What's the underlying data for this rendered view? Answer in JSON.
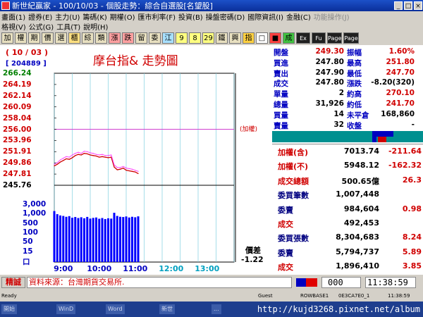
{
  "window": {
    "title": "新世紀贏家 - 100/10/03 - 個股走勢：綜合自選股[名望股]"
  },
  "menu": {
    "row1": [
      "畫面(1)",
      "證券(E)",
      "主力(U)",
      "籌碼(K)",
      "期權(O)",
      "匯市利率(F)",
      "投資(B)",
      "操盤密碼(D)",
      "國際資訊(I)",
      "金融(C)",
      "功能操作(J)"
    ],
    "row1_disabled": "功能操作(J)",
    "row2": [
      "格視(V)",
      "公式(G)",
      "工具(T)",
      "說明(H)"
    ]
  },
  "toolbar": {
    "chars": [
      "加",
      "權",
      "期",
      "價",
      "選",
      "櫃",
      "綜",
      "類",
      "漲",
      "跌",
      "留",
      "委",
      "江",
      "9",
      "8",
      "29",
      "鐵",
      "興",
      "指",
      "□",
      "■",
      "成",
      "Ex",
      "Fu",
      "Page",
      "Page"
    ],
    "colors": [
      "#e8e0c0",
      "#e8e0c0",
      "#e8e0c0",
      "#e8e0c0",
      "#e8e0c0",
      "#ffe080",
      "#e8e0c0",
      "#e8e0c0",
      "#ffa0a0",
      "#ffa0a0",
      "#e8e0c0",
      "#e8e0c0",
      "#a8e0ff",
      "#ffff80",
      "#ffff80",
      "#ffff80",
      "#e8e0c0",
      "#e8e0c0",
      "#ffd040",
      "#ffffff",
      "#ff4040",
      "#40c040",
      "#202020",
      "#202020",
      "#202020",
      "#202020"
    ]
  },
  "chart": {
    "date_badge": "( 10 / 03 )",
    "volume_badge": "[ 204889 ]",
    "title": "摩台指&  走勢圖",
    "ref_tag": "(加權)",
    "diff_label": "價差",
    "diff_value": "-1.22",
    "price_ticks": [
      {
        "label": "266.24",
        "color": "#008000"
      },
      {
        "label": "264.19",
        "color": "#d00000"
      },
      {
        "label": "262.14",
        "color": "#d00000"
      },
      {
        "label": "260.09",
        "color": "#d00000"
      },
      {
        "label": "258.04",
        "color": "#d00000"
      },
      {
        "label": "256.00",
        "color": "#d00000"
      },
      {
        "label": "253.96",
        "color": "#d00000"
      },
      {
        "label": "251.91",
        "color": "#d00000"
      },
      {
        "label": "249.86",
        "color": "#d00000"
      },
      {
        "label": "247.81",
        "color": "#d00000"
      },
      {
        "label": "245.76",
        "color": "#000000"
      }
    ],
    "volume_ticks": [
      "3,000",
      "1,000",
      "500",
      "100",
      "50",
      "15",
      "口"
    ],
    "time_ticks": [
      {
        "label": "9:00",
        "color": "#0000c0"
      },
      {
        "label": "10:00",
        "color": "#0000c0"
      },
      {
        "label": "11:00",
        "color": "#0000c0"
      },
      {
        "label": "12:00",
        "color": "#00a0c0"
      },
      {
        "label": "13:00",
        "color": "#00a0c0"
      }
    ]
  },
  "chart_data": {
    "type": "line",
    "title": "摩台指&  走勢圖",
    "x_unit": "minutes since 8:45",
    "xlim": [
      0,
      300
    ],
    "ylim": [
      245.76,
      266.24
    ],
    "reference_price": 256.0,
    "series": [
      {
        "name": "價",
        "color": "#d00000",
        "x": [
          0,
          5,
          10,
          15,
          20,
          25,
          30,
          35,
          40,
          45,
          50,
          55,
          60,
          65,
          70,
          75,
          80,
          85,
          90,
          95,
          100,
          105,
          110,
          115,
          120,
          125,
          130,
          135,
          140
        ],
        "values": [
          249.3,
          249.6,
          250.0,
          250.3,
          250.6,
          250.5,
          250.8,
          251.2,
          251.4,
          251.3,
          251.6,
          251.5,
          251.3,
          251.2,
          251.1,
          250.9,
          251.0,
          250.9,
          250.8,
          250.9,
          249.1,
          248.6,
          248.7,
          248.9,
          248.5,
          248.4,
          248.3,
          248.2,
          247.9
        ]
      },
      {
        "name": "加權",
        "color": "#ff40ff",
        "x": [
          0,
          5,
          10,
          15,
          20,
          25,
          30,
          35,
          40,
          45,
          50,
          55,
          60,
          65,
          70,
          75,
          80,
          85,
          90,
          95,
          100,
          105,
          110,
          115,
          120,
          125,
          130,
          135,
          140
        ],
        "values": [
          249.6,
          249.9,
          250.4,
          250.7,
          251.0,
          250.9,
          251.3,
          251.6,
          251.8,
          251.6,
          252.0,
          251.9,
          251.7,
          251.6,
          251.4,
          251.3,
          251.4,
          251.2,
          251.2,
          251.3,
          249.5,
          249.0,
          249.0,
          249.2,
          248.9,
          248.8,
          248.7,
          248.5,
          248.3
        ]
      }
    ],
    "volume": [
      1400,
      900,
      750,
      700,
      620,
      680,
      540,
      600,
      520,
      580,
      500,
      610,
      480,
      530,
      560,
      470,
      520,
      450,
      500,
      480,
      1100,
      700,
      620,
      600,
      650,
      560,
      620,
      580,
      660
    ]
  },
  "quote": {
    "rows": [
      {
        "l1": "開盤",
        "v1": "249.30",
        "l2": "振幅",
        "v2": "1.60%",
        "c1": "#d00000",
        "c2": "#d00000"
      },
      {
        "l1": "買進",
        "v1": "247.80",
        "l2": "最高",
        "v2": "251.80",
        "c1": "#000000",
        "c2": "#d00000"
      },
      {
        "l1": "賣出",
        "v1": "247.90",
        "l2": "最低",
        "v2": "247.70",
        "c1": "#000000",
        "c2": "#d00000"
      },
      {
        "l1": "成交",
        "v1": "247.80",
        "l2": "漲跌",
        "v2": "-8.20(320)",
        "c1": "#000000",
        "c2": "#000000"
      },
      {
        "l1": "單量",
        "v1": "2",
        "l2": "約高",
        "v2": "270.10",
        "c1": "#000000",
        "c2": "#d00000"
      },
      {
        "l1": "總量",
        "v1": "31,926",
        "l2": "約低",
        "v2": "241.70",
        "c1": "#000000",
        "c2": "#d00000"
      },
      {
        "l1": "買量",
        "v1": "14",
        "l2": "未平倉",
        "v2": "168,860",
        "c1": "#000000",
        "c2": "#000000"
      },
      {
        "l1": "賣量",
        "v1": "32",
        "l2": "收盤",
        "v2": "-",
        "c1": "#000000",
        "c2": "#000000"
      }
    ],
    "bottom": [
      {
        "label": "加權(含)",
        "v1": "7013.74",
        "v2": "-211.64"
      },
      {
        "label": "加權(不)",
        "v1": "5948.12",
        "v2": "-162.32"
      },
      {
        "label": "成交總額",
        "v1": "500.65億",
        "v2": "26.3"
      },
      {
        "label": "委買筆數",
        "v1": "1,007,448",
        "v2": ""
      },
      {
        "label": "委賣",
        "v1": "984,604",
        "v2": "0.98"
      },
      {
        "label": "成交",
        "v1": "492,453",
        "v2": ""
      },
      {
        "label": "委買張數",
        "v1": "8,304,683",
        "v2": "8.24"
      },
      {
        "label": "委賣",
        "v1": "5,794,737",
        "v2": "5.89"
      },
      {
        "label": "成交",
        "v1": "1,896,410",
        "v2": "3.85"
      }
    ]
  },
  "status": {
    "button": "精誠",
    "source": "資料來源：台灣期貨交易所.",
    "code": "000",
    "time": "11:38:59"
  },
  "sysbar": [
    "Ready",
    "Guest",
    "ROWBASE1",
    "0E3CA7E0_1",
    "11:38:59"
  ],
  "taskbar": {
    "items": [
      "開始",
      "WinD",
      "Word",
      "新世",
      "..."
    ],
    "url": "http://kujd3268.pixnet.net/album"
  }
}
